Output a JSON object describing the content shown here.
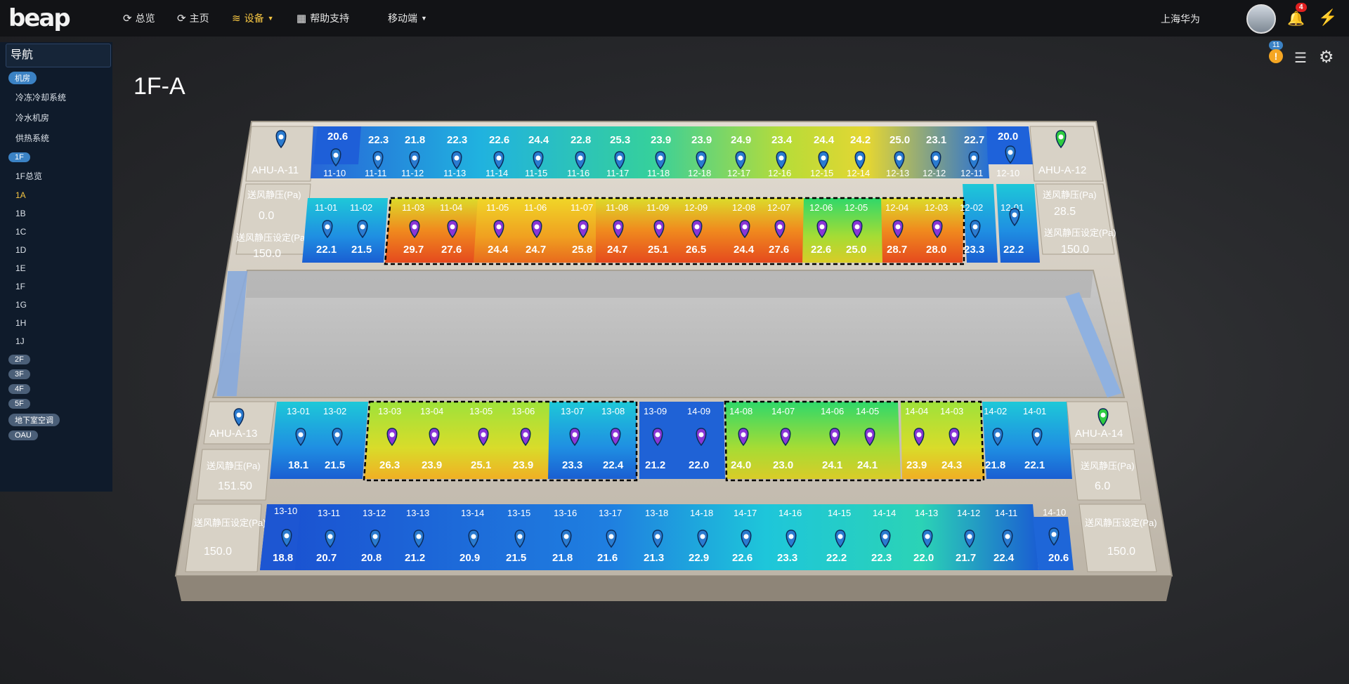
{
  "logo": "beap",
  "topnav": {
    "overview": "总览",
    "home": "主页",
    "equipment": "设备",
    "help": "帮助支持",
    "mobile": "移动端"
  },
  "user": {
    "name": "上海华为",
    "notif_count": "4"
  },
  "alerts": {
    "count": "11"
  },
  "sidebar": {
    "title": "导航",
    "jifang": "机房",
    "jifang_items": [
      "冷冻冷却系统",
      "冷水机房",
      "供热系统"
    ],
    "f1": "1F",
    "f1_items": [
      "1F总览",
      "1A",
      "1B",
      "1C",
      "1D",
      "1E",
      "1F",
      "1G",
      "1H",
      "1J"
    ],
    "active_item": "1A",
    "floors": [
      "2F",
      "3F",
      "4F",
      "5F",
      "地下室空调",
      "OAU"
    ]
  },
  "page_title": "1F-A",
  "ahu": {
    "a11": "AHU-A-11",
    "a12": "AHU-A-12",
    "a13": "AHU-A-13",
    "a14": "AHU-A-14"
  },
  "pressure": {
    "label": "送风静压(Pa)",
    "set_label": "送风静压设定(Pa)",
    "a11_value": "0.0",
    "a11_set": "150.0",
    "a12_value": "28.5",
    "a12_set": "150.0",
    "a13_value": "151.50",
    "a13_set": "150.0",
    "a14_value": "6.0",
    "a14_set": "150.0"
  },
  "colors": {
    "cool": "#1f63d8",
    "cyan": "#19c6d6",
    "green": "#2fd86a",
    "yellow": "#e6e028",
    "orange": "#f08a1e",
    "red": "#e53a1e",
    "pin_blue": "#2a7bd0",
    "pin_purple": "#8a35d6",
    "pin_green": "#2ecc40"
  },
  "rooms_top_row": [
    {
      "label": "11-10",
      "value": "20.6"
    },
    {
      "label": "11-11",
      "value": "22.3"
    },
    {
      "label": "11-12",
      "value": "21.8"
    },
    {
      "label": "11-13",
      "value": "22.3"
    },
    {
      "label": "11-14",
      "value": "22.6"
    },
    {
      "label": "11-15",
      "value": "24.4"
    },
    {
      "label": "11-16",
      "value": "22.8"
    },
    {
      "label": "11-17",
      "value": "25.3"
    },
    {
      "label": "11-18",
      "value": "23.9"
    },
    {
      "label": "12-18",
      "value": "23.9"
    },
    {
      "label": "12-17",
      "value": "24.9"
    },
    {
      "label": "12-16",
      "value": "23.4"
    },
    {
      "label": "12-15",
      "value": "24.4"
    },
    {
      "label": "12-14",
      "value": "24.2"
    },
    {
      "label": "12-13",
      "value": "25.0"
    },
    {
      "label": "12-12",
      "value": "23.1"
    },
    {
      "label": "12-11",
      "value": "22.7"
    },
    {
      "label": "12-10",
      "value": "20.0"
    }
  ],
  "rooms_row2": [
    {
      "label": "11-01",
      "value": "22.1"
    },
    {
      "label": "11-02",
      "value": "21.5"
    },
    {
      "label": "11-03",
      "value": "29.7"
    },
    {
      "label": "11-04",
      "value": "27.6"
    },
    {
      "label": "11-05",
      "value": "24.4"
    },
    {
      "label": "11-06",
      "value": "24.7"
    },
    {
      "label": "11-07",
      "value": "25.8"
    },
    {
      "label": "11-08",
      "value": "24.7"
    },
    {
      "label": "11-09",
      "value": "25.1"
    },
    {
      "label": "12-09",
      "value": "26.5"
    },
    {
      "label": "12-08",
      "value": "24.4"
    },
    {
      "label": "12-07",
      "value": "27.6"
    },
    {
      "label": "12-06",
      "value": "22.6"
    },
    {
      "label": "12-05",
      "value": "25.0"
    },
    {
      "label": "12-04",
      "value": "28.7"
    },
    {
      "label": "12-03",
      "value": "28.0"
    },
    {
      "label": "12-02",
      "value": "23.3"
    },
    {
      "label": "12-01",
      "value": "22.2"
    }
  ],
  "rooms_row3": [
    {
      "label": "13-01",
      "value": "18.1"
    },
    {
      "label": "13-02",
      "value": "21.5"
    },
    {
      "label": "13-03",
      "value": "26.3"
    },
    {
      "label": "13-04",
      "value": "23.9"
    },
    {
      "label": "13-05",
      "value": "25.1"
    },
    {
      "label": "13-06",
      "value": "23.9"
    },
    {
      "label": "13-07",
      "value": "23.3"
    },
    {
      "label": "13-08",
      "value": "22.4"
    },
    {
      "label": "13-09",
      "value": "21.2"
    },
    {
      "label": "14-09",
      "value": "22.0"
    },
    {
      "label": "14-08",
      "value": "24.0"
    },
    {
      "label": "14-07",
      "value": "23.0"
    },
    {
      "label": "14-06",
      "value": "24.1"
    },
    {
      "label": "14-05",
      "value": "24.1"
    },
    {
      "label": "14-04",
      "value": "23.9"
    },
    {
      "label": "14-03",
      "value": "24.3"
    },
    {
      "label": "14-02",
      "value": "21.8"
    },
    {
      "label": "14-01",
      "value": "22.1"
    }
  ],
  "rooms_bottom_row": [
    {
      "label": "13-10",
      "value": "18.8"
    },
    {
      "label": "13-11",
      "value": "20.7"
    },
    {
      "label": "13-12",
      "value": "20.8"
    },
    {
      "label": "13-13",
      "value": "21.2"
    },
    {
      "label": "13-14",
      "value": "20.9"
    },
    {
      "label": "13-15",
      "value": "21.5"
    },
    {
      "label": "13-16",
      "value": "21.8"
    },
    {
      "label": "13-17",
      "value": "21.6"
    },
    {
      "label": "13-18",
      "value": "21.3"
    },
    {
      "label": "14-18",
      "value": "22.9"
    },
    {
      "label": "14-17",
      "value": "22.6"
    },
    {
      "label": "14-16",
      "value": "23.3"
    },
    {
      "label": "14-15",
      "value": "22.2"
    },
    {
      "label": "14-14",
      "value": "22.3"
    },
    {
      "label": "14-13",
      "value": "22.0"
    },
    {
      "label": "14-12",
      "value": "21.7"
    },
    {
      "label": "14-11",
      "value": "22.4"
    },
    {
      "label": "14-10",
      "value": "20.6"
    }
  ]
}
